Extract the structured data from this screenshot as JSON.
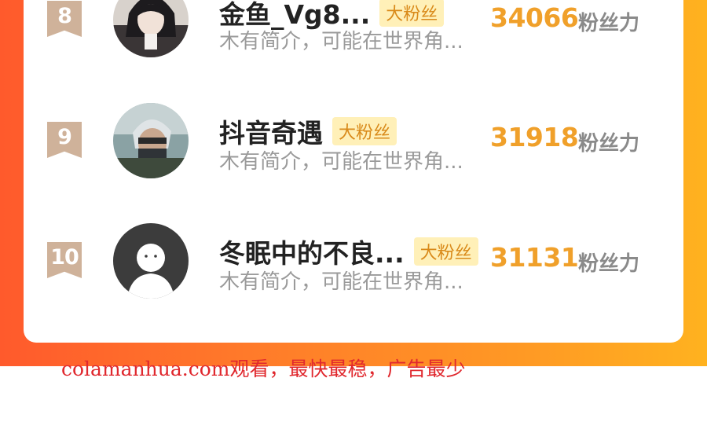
{
  "ranking": [
    {
      "rank": "8",
      "name": "金鱼_Vg8...",
      "tag": "大粉丝",
      "intro": "木有简介，可能在世界角...",
      "score": "34066",
      "score_unit": "粉丝力",
      "avatar": "anime-character-avatar"
    },
    {
      "rank": "9",
      "name": "抖音奇遇",
      "tag": "大粉丝",
      "intro": "木有简介，可能在世界角...",
      "score": "31918",
      "score_unit": "粉丝力",
      "avatar": "masked-ninja-avatar"
    },
    {
      "rank": "10",
      "name": "冬眠中的不良...",
      "tag": "大粉丝",
      "intro": "木有简介，可能在世界角...",
      "score": "31131",
      "score_unit": "粉丝力",
      "avatar": "default-user-avatar"
    }
  ],
  "watermark": "colamanhua.com观看，最快最稳，广告最少",
  "colors": {
    "gradient_start": "#ff5a2c",
    "gradient_end": "#ffb21f",
    "score": "#f0a02a",
    "tag_bg": "#fff0b8",
    "rank_badge": "#cfb29a",
    "watermark": "#e0282e"
  }
}
